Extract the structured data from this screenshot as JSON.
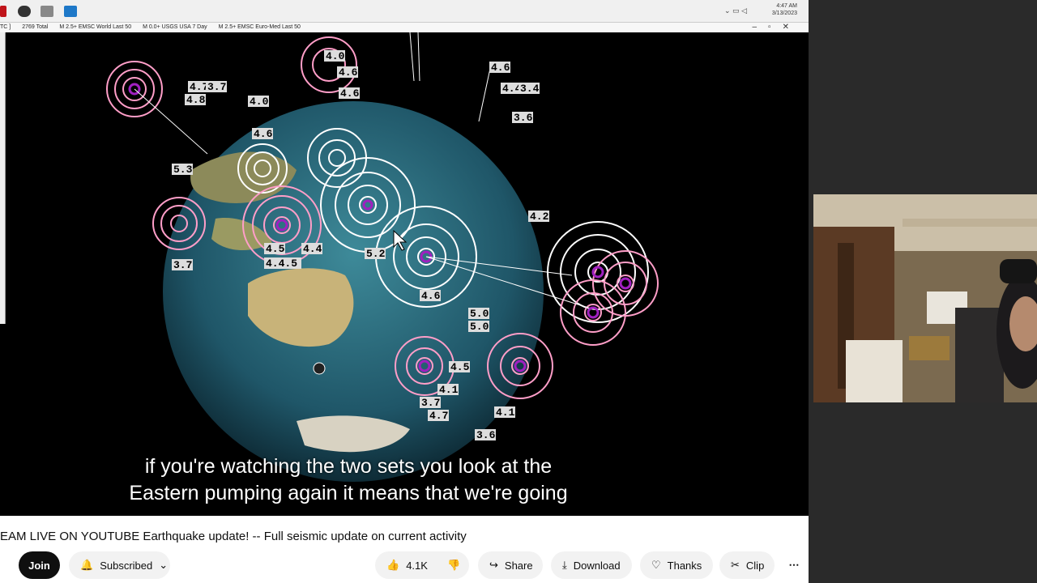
{
  "taskbar": {
    "clock_time": "4:47 AM",
    "clock_date": "3/13/2023",
    "tray_chevron": "chevron-up-icon"
  },
  "infobar": {
    "items": [
      "TC ]",
      "2769  Total",
      "M 2.5+  EMSC World Last 50",
      "M 0.0+  USGS USA 7 Day",
      "M 2.5+  EMSC Euro-Med Last 50"
    ]
  },
  "globe": {
    "labels": [
      "4.7",
      "4.8",
      "3.7",
      "4.0",
      "4.6",
      "4.6",
      "5.3",
      "4.6",
      "4.4",
      "3.4",
      "3.6",
      "4.2",
      "4.5",
      "4.4",
      "4.4.5",
      "3.7",
      "5.2",
      "4.6",
      "5.0",
      "5.0",
      "4.5",
      "4.1",
      "3.7",
      "4.7",
      "4.1",
      "3.6",
      "4.6",
      "4.0"
    ]
  },
  "captions": {
    "line1": "if you're watching the two sets you look at the",
    "line2": "Eastern pumping again it means that we're going"
  },
  "video": {
    "title": "EAM LIVE ON YOUTUBE Earthquake update! -- Full seismic update on current activity"
  },
  "actions": {
    "join": "Join",
    "subscribed": "Subscribed",
    "likes": "4.1K",
    "share": "Share",
    "download": "Download",
    "thanks": "Thanks",
    "clip": "Clip",
    "more": "⋯"
  },
  "colors": {
    "ring_pink": "#ff9ec8",
    "ring_white": "#ffffff",
    "ocean": "#1d4f66",
    "land": "#c9b37a"
  }
}
